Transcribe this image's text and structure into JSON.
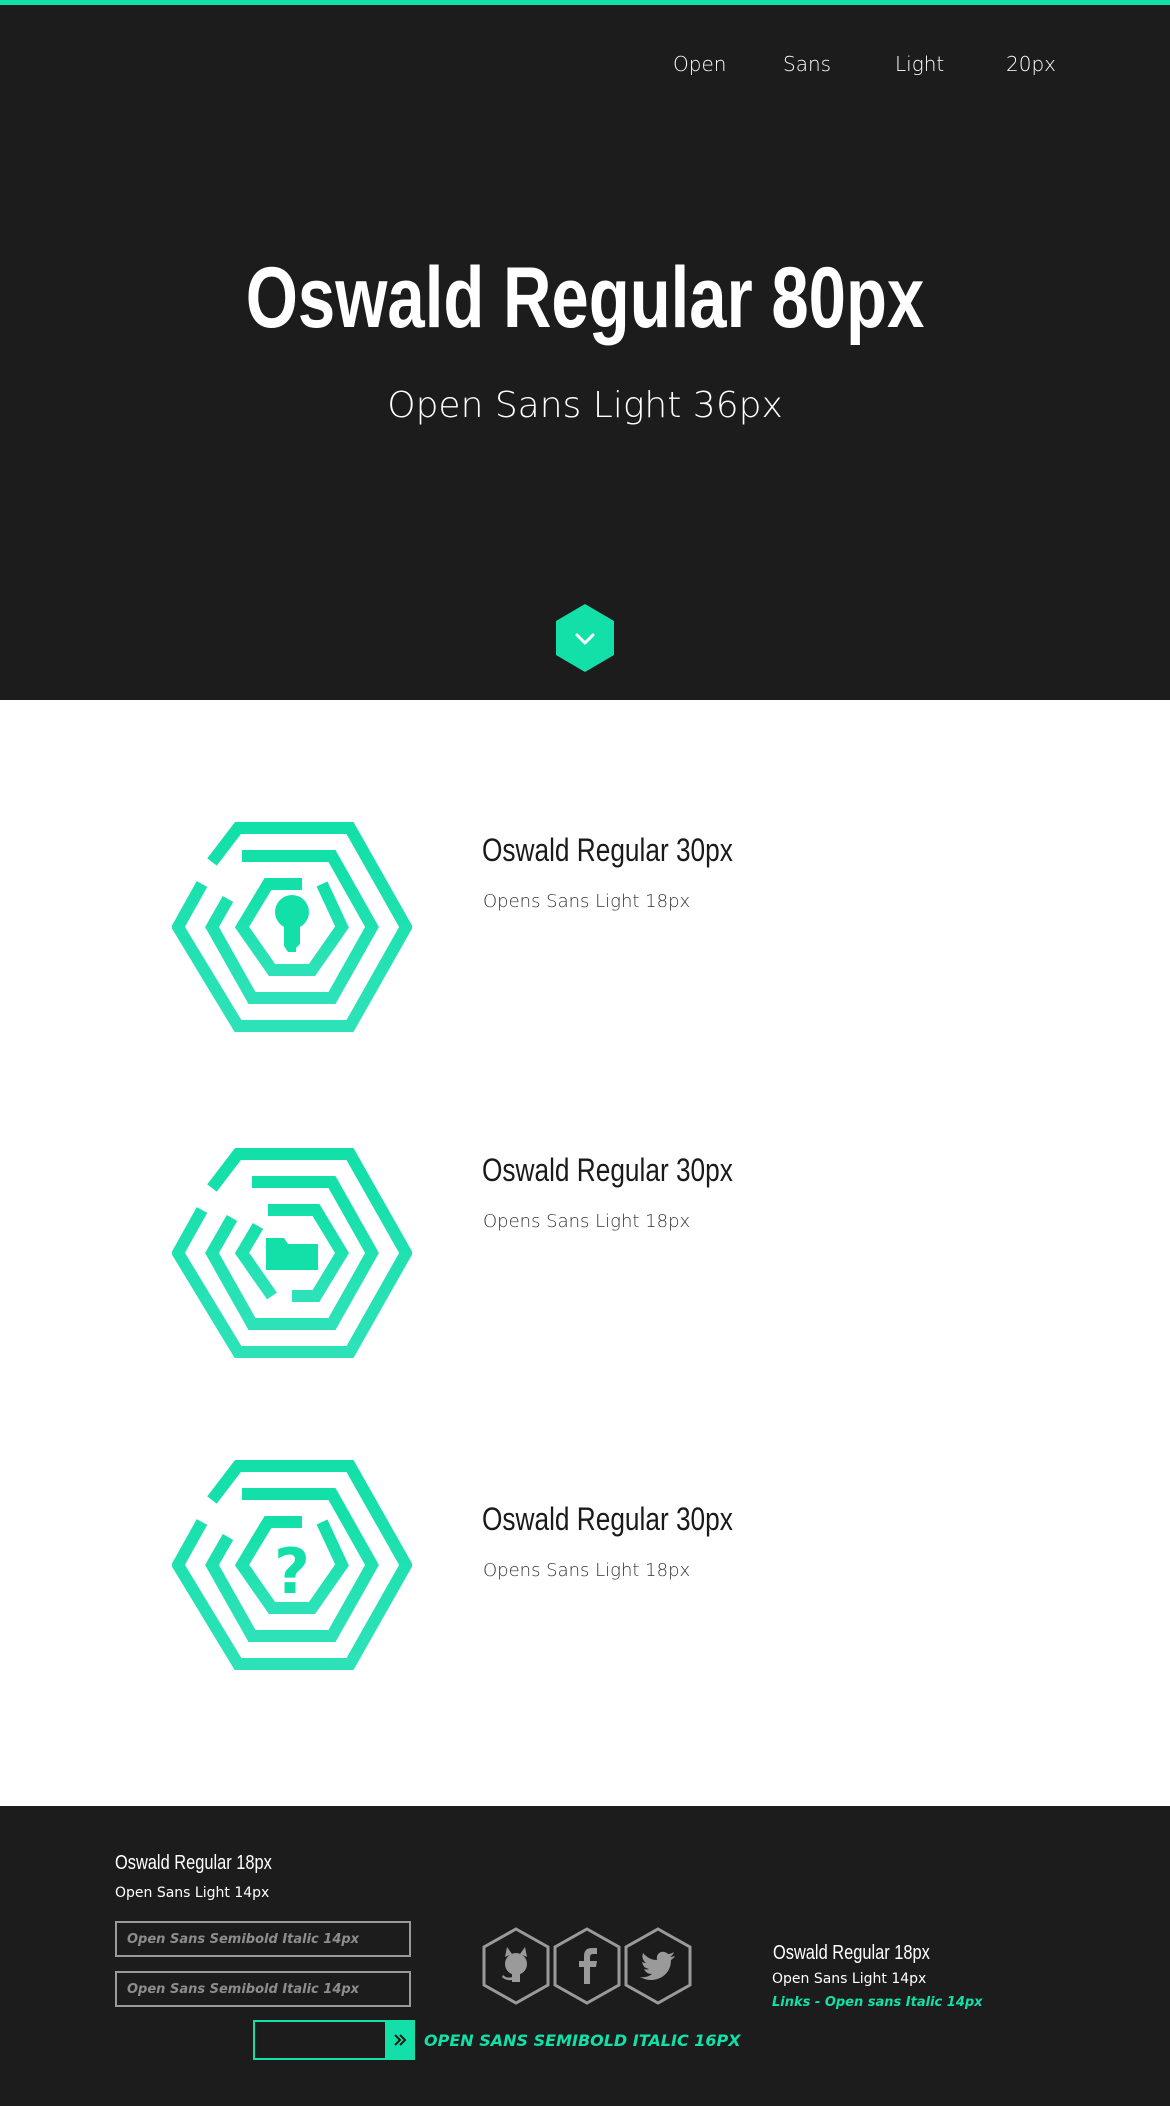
{
  "colors": {
    "accent": "#12e0a8",
    "dark": "#1c1c1c",
    "white": "#ffffff",
    "gray": "#8d8d8d"
  },
  "nav": {
    "items": [
      {
        "label": "Open"
      },
      {
        "label": "Sans"
      },
      {
        "label": "Light"
      },
      {
        "label": "20px"
      }
    ]
  },
  "hero": {
    "title": "Oswald Regular 80px",
    "subtitle": "Open Sans Light 36px",
    "scroll_icon": "chevron-down-icon"
  },
  "features": [
    {
      "icon": "keyhole-maze-icon",
      "title": "Oswald Regular 30px",
      "subtitle": "Opens Sans Light 18px"
    },
    {
      "icon": "folder-maze-icon",
      "title": "Oswald Regular 30px",
      "subtitle": "Opens Sans Light 18px"
    },
    {
      "icon": "question-maze-icon",
      "title": "Oswald Regular 30px",
      "subtitle": "Opens Sans Light 18px"
    }
  ],
  "footer": {
    "left": {
      "title": "Oswald Regular 18px",
      "subtitle": "Open Sans Light 14px",
      "input1_placeholder": "Open Sans Semibold Italic 14px",
      "input2_placeholder": "Open Sans Semibold Italic 14px",
      "submit_label": "OPEN SANS SEMIBOLD ITALIC 16PX"
    },
    "social": [
      {
        "icon": "github-icon"
      },
      {
        "icon": "facebook-icon"
      },
      {
        "icon": "twitter-icon"
      }
    ],
    "right": {
      "title": "Oswald Regular 18px",
      "subtitle": "Open Sans Light 14px",
      "link": "Links - Open sans Italic 14px"
    }
  }
}
